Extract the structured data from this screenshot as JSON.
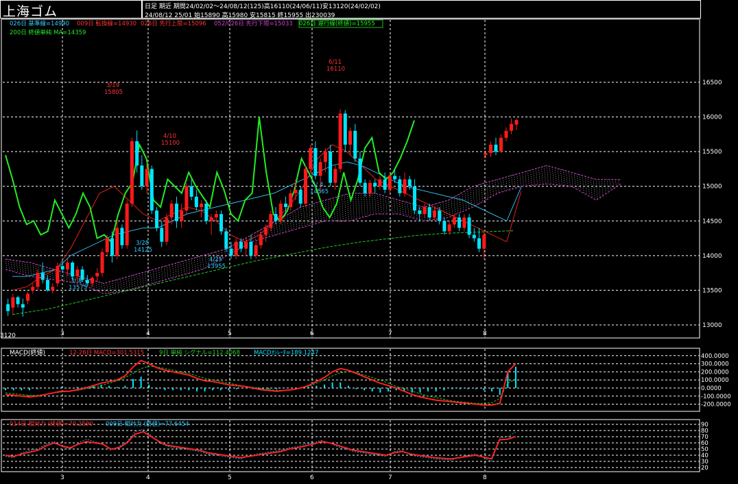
{
  "title": "上海ゴム",
  "header": {
    "line1": "日足  期近  期間24/02/02～24/08/12(125)高16110(24/06/11)安13120(24/02/02)",
    "line2": "24/08/12 25/01 始15890 高15980 安15815 終15955 出230039"
  },
  "legend": {
    "kijun": "026日 基準線=14990",
    "tenkan": "009日 転換線=14930",
    "senkou_a": "026日 先行上限=15096",
    "senkou_b": "052/026日 先行下限=15033",
    "chikou": "026日 遅行線(終値)=15955",
    "ma": "200日 終値単純 MA=14359"
  },
  "macd_legend": {
    "name": "MACD(終値)",
    "macd": "12-26日 MACD=301.5315",
    "signal": "9日 単純 シグナル=112.4068",
    "osc": "MACDｵｼﾚｰﾀ=189.1247"
  },
  "rsi_legend": {
    "rsi14": "014日 相対力 (終値)=70.2590",
    "rsi9": "009日 相対力 (終値)=77.6454"
  },
  "colors": {
    "up": "#ff1a1a",
    "down": "#00e5ff",
    "chikou": "#22ee22",
    "ma": "#22cc22",
    "kijun": "#33ccff",
    "tenkan": "#ff2222",
    "cloud": "#cc44cc",
    "macd": "#ff2222",
    "signal": "#22cc22",
    "osc": "#00e5ff"
  },
  "chart_data": [
    {
      "type": "candlestick",
      "panel": "price",
      "x_ticks": [
        "3",
        "4",
        "5",
        "6",
        "7",
        "8"
      ],
      "y_ticks": [
        "16500",
        "16000",
        "15500",
        "15000",
        "14500",
        "14000",
        "13500",
        "13000"
      ],
      "ylim": [
        13000,
        16600
      ],
      "low_label": "3120",
      "annotations": [
        {
          "date": "3/19",
          "value": "15805"
        },
        {
          "date": "4/10",
          "value": "15100"
        },
        {
          "date": "6/11",
          "value": "16110"
        },
        {
          "date": "3/ 8",
          "value": "13575"
        },
        {
          "date": "3/28",
          "value": "14125"
        },
        {
          "date": "4/25",
          "value": "13955"
        },
        {
          "date": "5/ 4",
          "value": "14565"
        }
      ],
      "candles": [
        [
          13300,
          13380,
          13130,
          13200
        ],
        [
          13250,
          13450,
          13150,
          13400
        ],
        [
          13400,
          13420,
          13250,
          13300
        ],
        [
          13300,
          13380,
          13120,
          13250
        ],
        [
          13350,
          13480,
          13300,
          13450
        ],
        [
          13500,
          13600,
          13450,
          13550
        ],
        [
          13550,
          13800,
          13500,
          13750
        ],
        [
          13750,
          13900,
          13600,
          13650
        ],
        [
          13650,
          13720,
          13480,
          13500
        ],
        [
          13500,
          13600,
          13450,
          13550
        ],
        [
          13600,
          13900,
          13550,
          13850
        ],
        [
          13850,
          13950,
          13750,
          13800
        ],
        [
          13800,
          13950,
          13700,
          13900
        ],
        [
          13900,
          13920,
          13650,
          13700
        ],
        [
          13700,
          13850,
          13600,
          13800
        ],
        [
          13800,
          13850,
          13620,
          13650
        ],
        [
          13650,
          13720,
          13560,
          13600
        ],
        [
          13600,
          13700,
          13550,
          13680
        ],
        [
          13700,
          13820,
          13620,
          13750
        ],
        [
          13750,
          14100,
          13700,
          14050
        ],
        [
          14050,
          14300,
          14000,
          14250
        ],
        [
          14250,
          14350,
          13900,
          14000
        ],
        [
          14000,
          14500,
          13950,
          14400
        ],
        [
          14400,
          14450,
          14100,
          14150
        ],
        [
          14150,
          14800,
          14100,
          14750
        ],
        [
          14750,
          15700,
          14700,
          15650
        ],
        [
          15650,
          15805,
          15200,
          15300
        ],
        [
          15300,
          15450,
          14950,
          15000
        ],
        [
          15000,
          15350,
          14900,
          15250
        ],
        [
          15250,
          15300,
          14600,
          14650
        ],
        [
          14650,
          14700,
          14350,
          14400
        ],
        [
          14400,
          14500,
          14125,
          14200
        ],
        [
          14200,
          14600,
          14150,
          14550
        ],
        [
          14550,
          14800,
          14450,
          14750
        ],
        [
          14750,
          14850,
          14400,
          14500
        ],
        [
          14500,
          14750,
          14400,
          14650
        ],
        [
          14650,
          15050,
          14600,
          15000
        ],
        [
          15000,
          15100,
          14800,
          14850
        ],
        [
          14850,
          14950,
          14650,
          14700
        ],
        [
          14700,
          14800,
          14550,
          14750
        ],
        [
          14750,
          14800,
          14450,
          14500
        ],
        [
          14500,
          14600,
          14300,
          14550
        ],
        [
          14550,
          14650,
          14500,
          14600
        ],
        [
          14600,
          14650,
          14300,
          14350
        ],
        [
          14350,
          14400,
          14050,
          14100
        ],
        [
          14100,
          14200,
          13955,
          14000
        ],
        [
          14000,
          14250,
          13950,
          14200
        ],
        [
          14200,
          14250,
          14050,
          14100
        ],
        [
          14100,
          14250,
          14000,
          14200
        ],
        [
          14200,
          14300,
          13950,
          14000
        ],
        [
          14000,
          14200,
          13950,
          14150
        ],
        [
          14150,
          14350,
          14100,
          14300
        ],
        [
          14300,
          14450,
          14200,
          14400
        ],
        [
          14400,
          14650,
          14350,
          14600
        ],
        [
          14600,
          14700,
          14450,
          14500
        ],
        [
          14500,
          14800,
          14450,
          14750
        ],
        [
          14750,
          14850,
          14600,
          14700
        ],
        [
          14700,
          14950,
          14650,
          14900
        ],
        [
          14900,
          15100,
          14800,
          14950
        ],
        [
          14950,
          15000,
          14700,
          14750
        ],
        [
          14750,
          15300,
          14700,
          15250
        ],
        [
          15250,
          15600,
          15200,
          15550
        ],
        [
          15550,
          15650,
          15100,
          15150
        ],
        [
          15150,
          15400,
          14900,
          15350
        ],
        [
          15350,
          15550,
          15200,
          15500
        ],
        [
          15500,
          15600,
          15000,
          15050
        ],
        [
          15050,
          15300,
          14950,
          15250
        ],
        [
          15250,
          16110,
          15200,
          16050
        ],
        [
          16050,
          16100,
          15500,
          15600
        ],
        [
          15600,
          15850,
          15450,
          15800
        ],
        [
          15800,
          15900,
          15350,
          15400
        ],
        [
          15400,
          15500,
          15000,
          15050
        ],
        [
          15050,
          15100,
          14850,
          14900
        ],
        [
          14900,
          15100,
          14850,
          15050
        ],
        [
          15050,
          15100,
          14900,
          15000
        ],
        [
          15000,
          15150,
          14950,
          15100
        ],
        [
          15100,
          15200,
          14900,
          14950
        ],
        [
          14950,
          15200,
          14900,
          15150
        ],
        [
          15150,
          15250,
          15050,
          15100
        ],
        [
          15100,
          15150,
          14850,
          14900
        ],
        [
          14900,
          15200,
          14850,
          15100
        ],
        [
          15100,
          15150,
          14950,
          15000
        ],
        [
          15000,
          15100,
          14600,
          14650
        ],
        [
          14650,
          14700,
          14500,
          14600
        ],
        [
          14600,
          14750,
          14550,
          14700
        ],
        [
          14700,
          14750,
          14500,
          14550
        ],
        [
          14550,
          14700,
          14500,
          14650
        ],
        [
          14650,
          14700,
          14450,
          14500
        ],
        [
          14500,
          14550,
          14300,
          14350
        ],
        [
          14350,
          14500,
          14300,
          14450
        ],
        [
          14450,
          14600,
          14400,
          14550
        ],
        [
          14550,
          14600,
          14350,
          14400
        ],
        [
          14400,
          14600,
          14350,
          14550
        ],
        [
          14550,
          14600,
          14250,
          14300
        ],
        [
          14300,
          14400,
          14200,
          14250
        ],
        [
          14250,
          14400,
          14050,
          14100
        ],
        [
          14100,
          14350,
          13950,
          14300
        ],
        [
          15450,
          15500,
          15400,
          15480
        ],
        [
          15480,
          15650,
          15420,
          15600
        ],
        [
          15600,
          15700,
          15450,
          15500
        ],
        [
          15500,
          15750,
          15480,
          15700
        ],
        [
          15700,
          15850,
          15650,
          15800
        ],
        [
          15800,
          15980,
          15750,
          15900
        ],
        [
          15890,
          15980,
          15815,
          15955
        ]
      ],
      "ma200": [
        13150,
        13170,
        13190,
        13210,
        13230,
        13260,
        13290,
        13320,
        13350,
        13380,
        13410,
        13440,
        13470,
        13500,
        13530,
        13560,
        13590,
        13620,
        13650,
        13680,
        13710,
        13740,
        13770,
        13800,
        13830,
        13860,
        13890,
        13920,
        13945,
        13970,
        13995,
        14020,
        14045,
        14070,
        14095,
        14120,
        14140,
        14160,
        14180,
        14200,
        14215,
        14230,
        14245,
        14260,
        14275,
        14290,
        14300,
        14310,
        14320,
        14325,
        14330,
        14335,
        14340,
        14345,
        14350,
        14355,
        14359
      ],
      "ichimoku": {
        "kijun": [
          13700,
          13700,
          13750,
          13800,
          14000,
          14100,
          14200,
          14300,
          14350,
          14400,
          14400,
          14500,
          14600,
          14650,
          14700,
          14750,
          14800,
          14850,
          14900,
          15000,
          15100,
          15200,
          15300,
          15350,
          15300,
          15200,
          15100,
          15000,
          14950,
          14900,
          14850,
          14800,
          14700,
          14600,
          14500,
          14990
        ],
        "tenkan": [
          13500,
          13550,
          13700,
          13800,
          14100,
          14500,
          14900,
          15000,
          14800,
          14600,
          14500,
          14600,
          14700,
          14650,
          14500,
          14300,
          14200,
          14300,
          14500,
          14700,
          15000,
          15400,
          15600,
          15500,
          15300,
          15100,
          15000,
          14900,
          14800,
          14700,
          14600,
          14500,
          14400,
          14300,
          14200,
          14930
        ],
        "senkou_a": [
          13950,
          13900,
          13800,
          13700,
          13600,
          13700,
          13800,
          13900,
          14000,
          14100,
          14300,
          14500,
          14700,
          14800,
          14900,
          14900,
          14800,
          14700,
          14800,
          15000,
          15100,
          15200,
          15300,
          15200,
          15100,
          15096
        ],
        "senkou_b": [
          13800,
          13700,
          13650,
          13600,
          13450,
          13500,
          13600,
          13700,
          13800,
          14000,
          14200,
          14300,
          14400,
          14500,
          14500,
          14600,
          14600,
          14500,
          14550,
          14700,
          14900,
          15000,
          15033,
          15000,
          14800,
          15033
        ]
      },
      "chikou": [
        15450,
        15100,
        14700,
        14450,
        14500,
        14300,
        14350,
        14800,
        14600,
        14400,
        14600,
        14900,
        14700,
        14250,
        14300,
        14200,
        14600,
        14900,
        15050,
        15600,
        15400,
        14800,
        14700,
        15100,
        15000,
        14900,
        15200,
        15000,
        14850,
        14700,
        15200,
        14950,
        14600,
        14500,
        14800,
        14900,
        16000,
        15200,
        14600,
        14500,
        14650,
        14950,
        15400,
        15200,
        15000,
        14700,
        14550,
        14750,
        15200,
        14800,
        15100,
        15550,
        15700,
        15200,
        15100,
        15200,
        15400,
        15650,
        15950
      ],
      "chikou_values_note": ""
    },
    {
      "type": "bar+line",
      "panel": "macd",
      "y_ticks": [
        "400.0000",
        "300.0000",
        "200.0000",
        "100.0000",
        "0.0000",
        "-100.0000",
        "-200.0000"
      ],
      "ylim": [
        -260,
        430
      ],
      "macd": [
        -80,
        -90,
        -100,
        -110,
        -100,
        -80,
        -60,
        -40,
        -40,
        -20,
        0,
        30,
        60,
        80,
        100,
        150,
        260,
        340,
        300,
        250,
        220,
        200,
        180,
        160,
        120,
        90,
        80,
        60,
        40,
        30,
        20,
        0,
        -20,
        -30,
        -40,
        -30,
        -20,
        0,
        30,
        80,
        130,
        200,
        240,
        220,
        180,
        140,
        100,
        60,
        30,
        0,
        -40,
        -80,
        -110,
        -130,
        -150,
        -160,
        -170,
        -180,
        -190,
        -200,
        -210,
        -210,
        -190,
        200,
        301.5315
      ],
      "signal": [
        -60,
        -70,
        -80,
        -90,
        -90,
        -80,
        -60,
        -50,
        -40,
        -30,
        -10,
        10,
        30,
        60,
        90,
        130,
        180,
        240,
        270,
        260,
        240,
        220,
        200,
        180,
        150,
        120,
        100,
        80,
        60,
        40,
        20,
        10,
        -5,
        -20,
        -30,
        -30,
        -20,
        -5,
        20,
        60,
        100,
        150,
        190,
        200,
        190,
        160,
        130,
        100,
        60,
        20,
        -10,
        -40,
        -70,
        -100,
        -120,
        -140,
        -160,
        -170,
        -180,
        -190,
        -190,
        -180,
        -130,
        60,
        112.4068
      ],
      "osc": [
        -20,
        -20,
        -20,
        -20,
        -10,
        0,
        0,
        10,
        0,
        10,
        10,
        20,
        30,
        20,
        10,
        20,
        80,
        100,
        30,
        -10,
        -20,
        -20,
        -20,
        -20,
        -30,
        -30,
        -20,
        -20,
        -20,
        -10,
        0,
        -10,
        -15,
        -10,
        -10,
        0,
        0,
        5,
        10,
        20,
        30,
        50,
        50,
        20,
        -10,
        -20,
        -30,
        -40,
        -30,
        -20,
        -30,
        -40,
        -40,
        -30,
        -30,
        -20,
        -10,
        -10,
        -10,
        -10,
        -20,
        -30,
        -60,
        140,
        189.1247
      ]
    },
    {
      "type": "line",
      "panel": "rsi",
      "y_ticks": [
        "90",
        "80",
        "70",
        "60",
        "50",
        "40",
        "30",
        "20"
      ],
      "ylim": [
        20,
        90
      ],
      "rsi14": [
        40,
        38,
        42,
        45,
        48,
        55,
        60,
        55,
        52,
        58,
        62,
        60,
        58,
        50,
        52,
        60,
        74,
        78,
        70,
        62,
        56,
        54,
        52,
        50,
        48,
        44,
        42,
        40,
        38,
        36,
        38,
        40,
        42,
        44,
        46,
        50,
        52,
        55,
        58,
        62,
        60,
        56,
        52,
        48,
        46,
        44,
        42,
        40,
        44,
        46,
        42,
        40,
        38,
        36,
        35,
        34,
        36,
        38,
        40,
        37,
        34,
        65,
        66,
        70.259
      ],
      "rsi9": [
        38,
        36,
        44,
        48,
        50,
        58,
        62,
        54,
        50,
        60,
        66,
        62,
        58,
        48,
        54,
        62,
        78,
        82,
        72,
        60,
        54,
        52,
        50,
        48,
        46,
        42,
        40,
        38,
        36,
        34,
        38,
        42,
        44,
        46,
        48,
        52,
        54,
        58,
        60,
        64,
        60,
        54,
        50,
        46,
        44,
        42,
        40,
        38,
        46,
        48,
        40,
        38,
        36,
        34,
        33,
        32,
        36,
        40,
        42,
        36,
        30,
        68,
        70,
        77.6454
      ]
    }
  ]
}
